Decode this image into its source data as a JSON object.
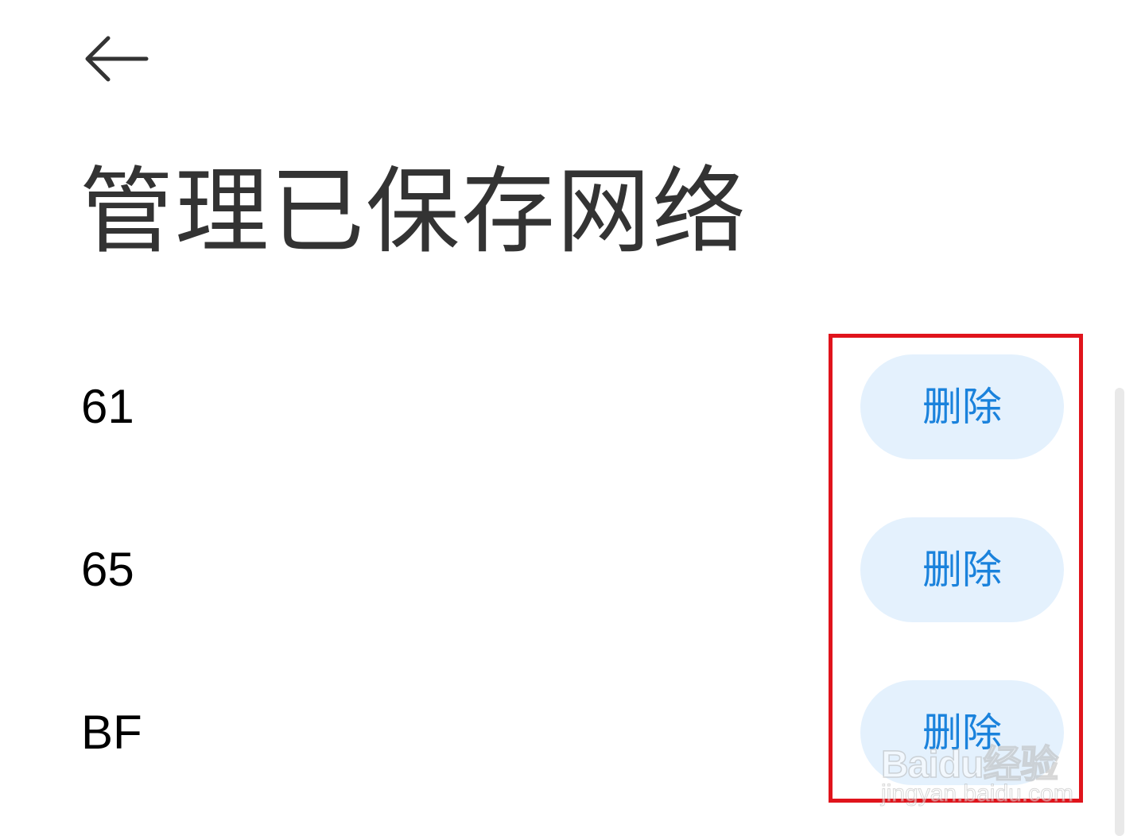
{
  "header": {
    "back_icon": "arrow-left-icon",
    "title": "管理已保存网络"
  },
  "networks": [
    {
      "name": "61",
      "action_label": "删除"
    },
    {
      "name": "65",
      "action_label": "删除"
    },
    {
      "name": "BF",
      "action_label": "删除"
    }
  ],
  "colors": {
    "title": "#333333",
    "button_bg": "#e4f1fd",
    "button_text": "#1a82dc",
    "highlight_border": "#e0141c"
  },
  "watermark": {
    "brand": "Baidu经验",
    "url": "jingyan.baidu.com"
  }
}
